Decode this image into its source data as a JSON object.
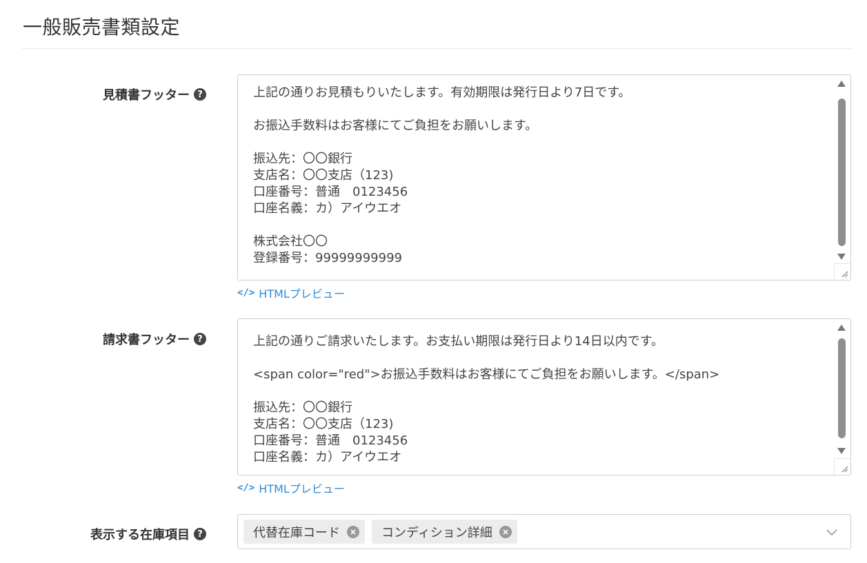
{
  "page": {
    "title": "一般販売書類設定"
  },
  "estimate_footer": {
    "label": "見積書フッター",
    "help": "?",
    "text": "上記の通りお見積もりいたします。有効期限は発行日より7日です。\n\nお振込手数料はお客様にてご負担をお願いします。\n\n振込先：〇〇銀行\n支店名：〇〇支店（123)\n口座番号：普通　0123456\n口座名義：カ）アイウエオ\n\n株式会社〇〇\n登録番号：99999999999",
    "preview_icon": "</>",
    "preview_label": "HTMLプレビュー"
  },
  "invoice_footer": {
    "label": "請求書フッター",
    "help": "?",
    "text": "上記の通りご請求いたします。お支払い期限は発行日より14日以内です。\n\n<span color=\"red\">お振込手数料はお客様にてご負担をお願いします。</span>\n\n振込先：〇〇銀行\n支店名：〇〇支店（123)\n口座番号：普通　0123456\n口座名義：カ）アイウエオ",
    "preview_icon": "</>",
    "preview_label": "HTMLプレビュー"
  },
  "stock_items": {
    "label": "表示する在庫項目",
    "help": "?",
    "tags": [
      "代替在庫コード",
      "コンディション詳細"
    ]
  },
  "icons": {
    "help": "question-circle-icon",
    "tag_remove": "close-circle-icon",
    "dropdown": "chevron-down-icon",
    "preview": "code-icon"
  },
  "colors": {
    "link": "#2f8bd6",
    "tag_bg": "#ececec",
    "border": "#cfcfcf"
  }
}
